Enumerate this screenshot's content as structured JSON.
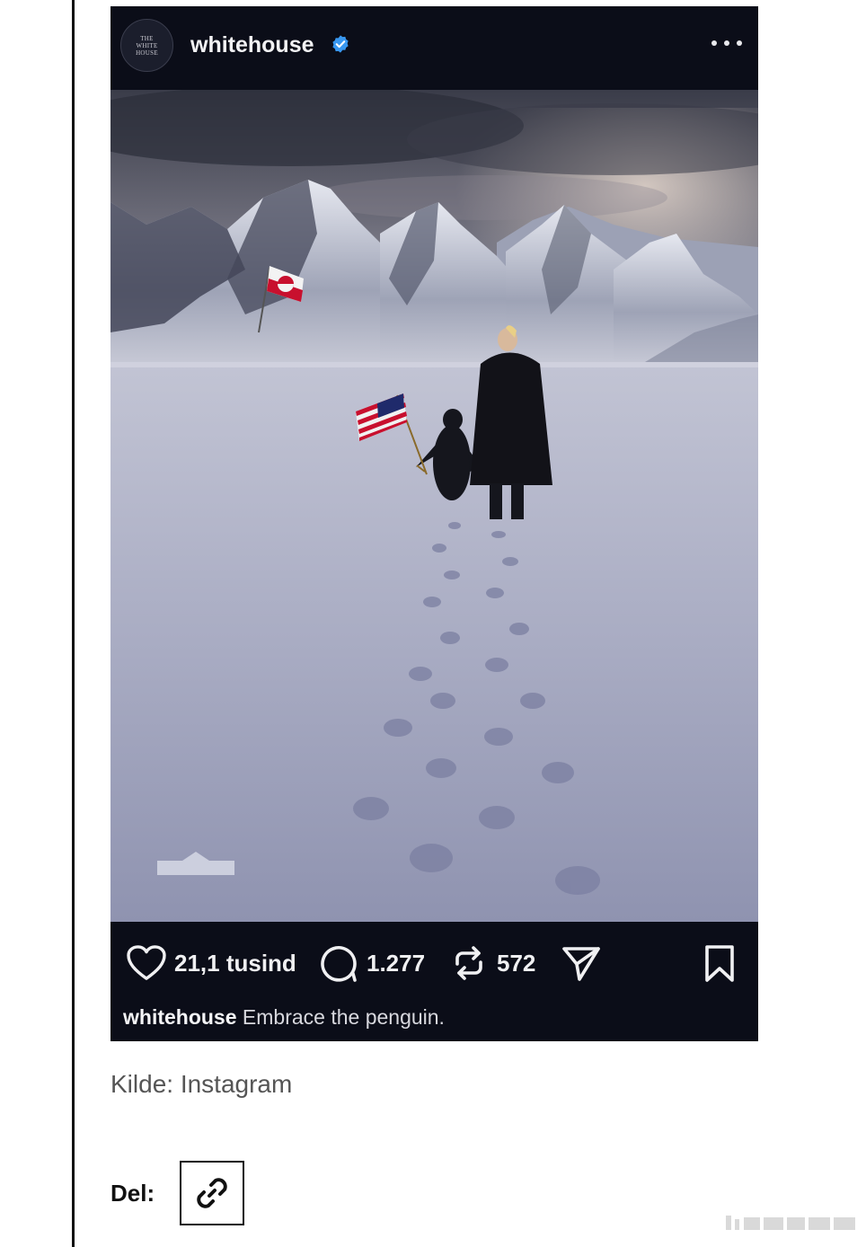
{
  "post": {
    "account": "whitehouse",
    "avatar_text": [
      "THE",
      "WHITE",
      "HOUSE"
    ],
    "likes": "21,1 tusind",
    "comments": "1.277",
    "reposts": "572",
    "caption_user": "whitehouse",
    "caption_text": " Embrace the penguin."
  },
  "source_text": "Kilde: Instagram",
  "share": {
    "label": "Del:"
  },
  "colors": {
    "verified": "#3897f0",
    "post_bg": "#0b0d18",
    "flag_red": "#c8102e"
  },
  "icons": [
    "verified-icon",
    "more-options-icon",
    "heart-icon",
    "comment-icon",
    "repost-icon",
    "share-icon",
    "bookmark-icon",
    "link-icon"
  ]
}
